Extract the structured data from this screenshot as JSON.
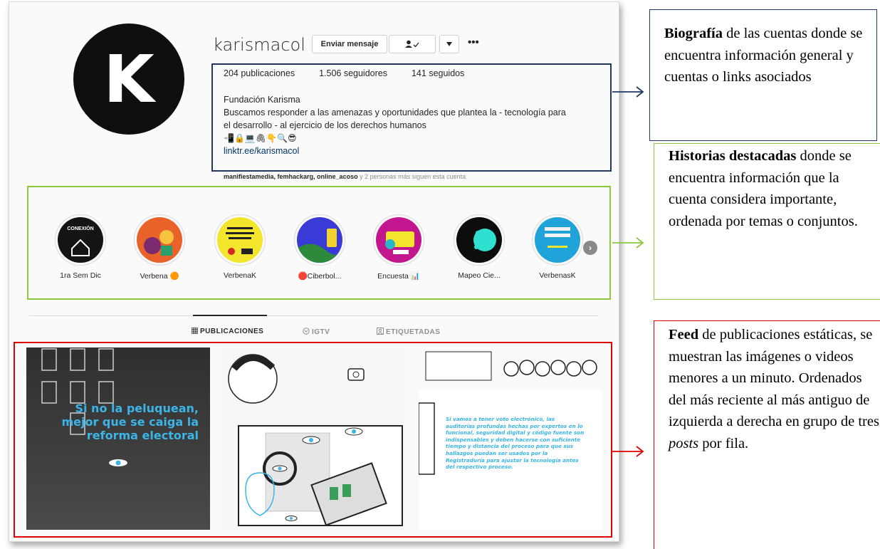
{
  "profile": {
    "avatar_letter": "K",
    "username": "karismacol",
    "message_button": "Enviar mensaje",
    "follow_icon": "person-check-icon",
    "more_label": "•••",
    "posts": "204 publicaciones",
    "followers": "1.506 seguidores",
    "following": "141 seguidos",
    "name": "Fundación Karisma",
    "bio_line1": "Buscamos responder a las amenazas y oportunidades que plantea la - tecnología para",
    "bio_line2": "el desarrollo - al ejercicio de los derechos humanos",
    "emoji": "📲🔒💻🖇👇🔍😎",
    "link": "linktr.ee/karismacol",
    "followed_by_names": "manifiestamedia, femhackarg, online_acoso",
    "followed_by_rest": "y 2 personas más siguen esta cuenta"
  },
  "highlights": [
    {
      "label": "1ra Sem Dic",
      "color": "#141414"
    },
    {
      "label": "Verbena 🟠",
      "color": "#e8622a"
    },
    {
      "label": "VerbenaK",
      "color": "#f2e52c"
    },
    {
      "label": "🛑Ciberbol...",
      "color": "#3a3ad6"
    },
    {
      "label": "Encuesta 📊",
      "color": "#c2168f"
    },
    {
      "label": "Mapeo Cie...",
      "color": "#0d0d0d"
    },
    {
      "label": "VerbenasK",
      "color": "#1fa3d8"
    }
  ],
  "tabs": [
    {
      "label": "PUBLICACIONES",
      "icon": "grid-icon",
      "active": true
    },
    {
      "label": "IGTV",
      "icon": "igtv-icon",
      "active": false
    },
    {
      "label": "ETIQUETADAS",
      "icon": "tag-icon",
      "active": false
    }
  ],
  "posts": {
    "post1_text": "Si no la peluquean, mejor que se caiga la reforma electoral",
    "post3_text": "Si vamos a tener voto electrónico, las auditorías profundas hechas por expertos en lo funcional, seguridad digital y código fuente son indispensables y deben hacerse con suficiente tiempo y distancia del proceso para que sus hallazgos puedan ser usados por la Registraduría para ajustar la tecnología antes del respectivo proceso.",
    "accent": "#3bb5e8"
  },
  "annotations": {
    "bio": {
      "bold": "Biografía",
      "rest": " de las cuentas donde se encuentra información general y cuentas o links asociados",
      "color": "#1f3864"
    },
    "highlights": {
      "bold": "Historias destacadas",
      "rest": " donde se encuentra información que la cuenta considera importante, ordenada por temas o conjuntos.",
      "color": "#8dc63f"
    },
    "feed": {
      "bold": "Feed",
      "rest1": " de publicaciones estáticas, se muestran las imágenes o videos menores a un minuto. Ordenados del más reciente al más antiguo de izquierda a derecha en grupo de tres ",
      "italic": "posts",
      "rest2": " por fila.",
      "color": "#e00000"
    }
  }
}
